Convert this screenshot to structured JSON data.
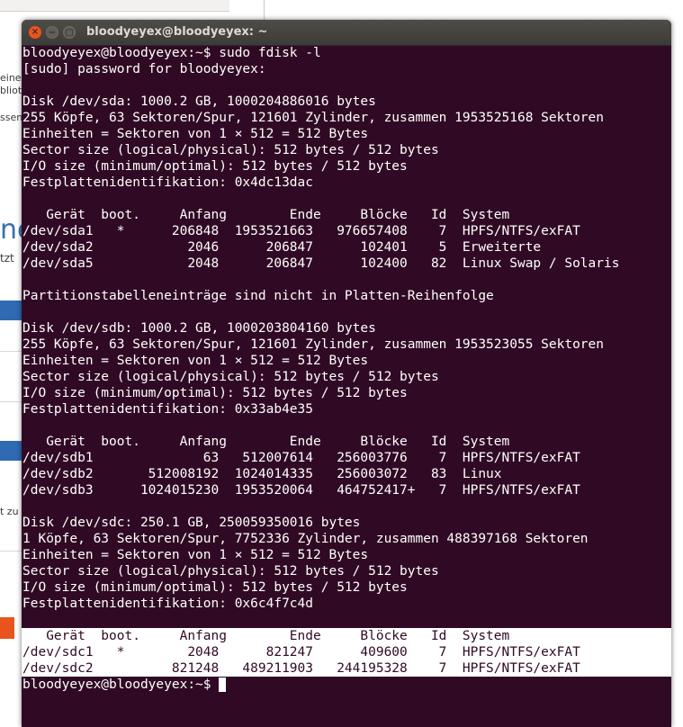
{
  "background_window": {
    "fragments": [
      "eine",
      "bliot",
      "ssen",
      "ne",
      "tzt",
      "t zu"
    ]
  },
  "terminal": {
    "title": "bloodyeyex@bloodyeyex: ~",
    "buttons": {
      "close": "×",
      "minimize": "−",
      "maximize": "□"
    },
    "lines": [
      "bloodyeyex@bloodyeyex:~$ sudo fdisk -l",
      "[sudo] password for bloodyeyex:",
      "",
      "Disk /dev/sda: 1000.2 GB, 1000204886016 bytes",
      "255 Köpfe, 63 Sektoren/Spur, 121601 Zylinder, zusammen 1953525168 Sektoren",
      "Einheiten = Sektoren von 1 × 512 = 512 Bytes",
      "Sector size (logical/physical): 512 bytes / 512 bytes",
      "I/O size (minimum/optimal): 512 bytes / 512 bytes",
      "Festplattenidentifikation: 0x4dc13dac",
      "",
      "   Gerät  boot.     Anfang        Ende     Blöcke   Id  System",
      "/dev/sda1   *      206848  1953521663   976657408    7  HPFS/NTFS/exFAT",
      "/dev/sda2            2046      206847      102401    5  Erweiterte",
      "/dev/sda5            2048      206847      102400   82  Linux Swap / Solaris",
      "",
      "Partitionstabelleneinträge sind nicht in Platten-Reihenfolge",
      "",
      "Disk /dev/sdb: 1000.2 GB, 1000203804160 bytes",
      "255 Köpfe, 63 Sektoren/Spur, 121601 Zylinder, zusammen 1953523055 Sektoren",
      "Einheiten = Sektoren von 1 × 512 = 512 Bytes",
      "Sector size (logical/physical): 512 bytes / 512 bytes",
      "I/O size (minimum/optimal): 512 bytes / 512 bytes",
      "Festplattenidentifikation: 0x33ab4e35",
      "",
      "   Gerät  boot.     Anfang        Ende     Blöcke   Id  System",
      "/dev/sdb1              63   512007614   256003776    7  HPFS/NTFS/exFAT",
      "/dev/sdb2       512008192  1024014335   256003072   83  Linux",
      "/dev/sdb3      1024015230  1953520064   464752417+   7  HPFS/NTFS/exFAT",
      "",
      "Disk /dev/sdc: 250.1 GB, 250059350016 bytes",
      "1 Köpfe, 63 Sektoren/Spur, 7752336 Zylinder, zusammen 488397168 Sektoren",
      "Einheiten = Sektoren von 1 × 512 = 512 Bytes",
      "Sector size (logical/physical): 512 bytes / 512 bytes",
      "I/O size (minimum/optimal): 512 bytes / 512 bytes",
      "Festplattenidentifikation: 0x6c4f7c4d",
      "",
      "   Gerät  boot.     Anfang        Ende     Blöcke   Id  System",
      "/dev/sdc1   *        2048      821247      409600    7  HPFS/NTFS/exFAT",
      "/dev/sdc2          821248   489211903   244195328    7  HPFS/NTFS/exFAT"
    ],
    "selected_lines": [
      36,
      37,
      38
    ],
    "prompt": "bloodyeyex@bloodyeyex:~$ ",
    "colors": {
      "background": "#300a24",
      "text": "#ffffff",
      "close_button": "#e95420"
    }
  }
}
